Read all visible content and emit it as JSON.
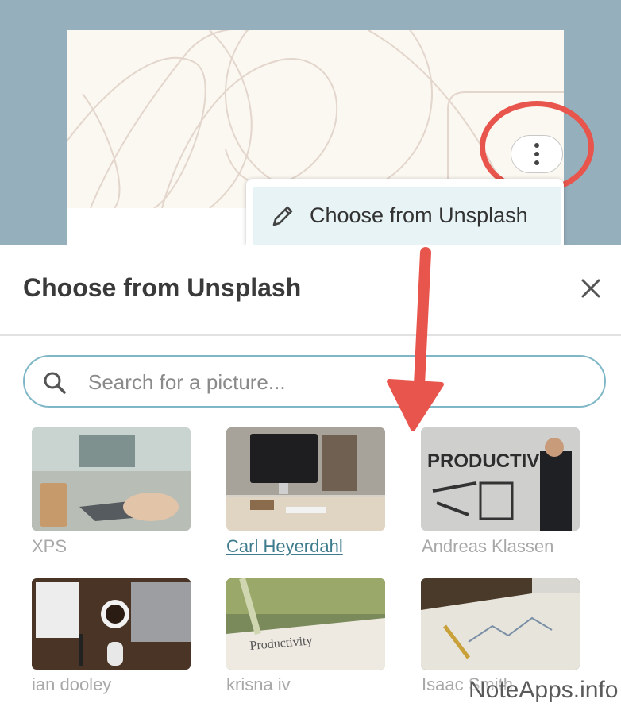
{
  "menu": {
    "item_label": "Choose from Unsplash",
    "icons": {
      "edit": "pencil-icon",
      "more": "more-vertical-icon"
    }
  },
  "modal": {
    "title": "Choose from Unsplash",
    "close_icon": "close-icon",
    "search": {
      "placeholder": "Search for a picture...",
      "value": "",
      "icon": "search-icon"
    },
    "photos": [
      {
        "author": "XPS",
        "linked": false
      },
      {
        "author": "Carl Heyerdahl",
        "linked": true
      },
      {
        "author": "Andreas Klassen",
        "linked": false
      },
      {
        "author": "ian dooley",
        "linked": false
      },
      {
        "author": "krisna iv",
        "linked": false
      },
      {
        "author": "Isaac Smith",
        "linked": false
      }
    ]
  },
  "watermark": "NoteApps.info",
  "colors": {
    "accent_teal": "#3e7b8c",
    "annotation_red": "#e8554c",
    "backdrop": "#95afbd",
    "menu_highlight": "#e8f3f5"
  }
}
